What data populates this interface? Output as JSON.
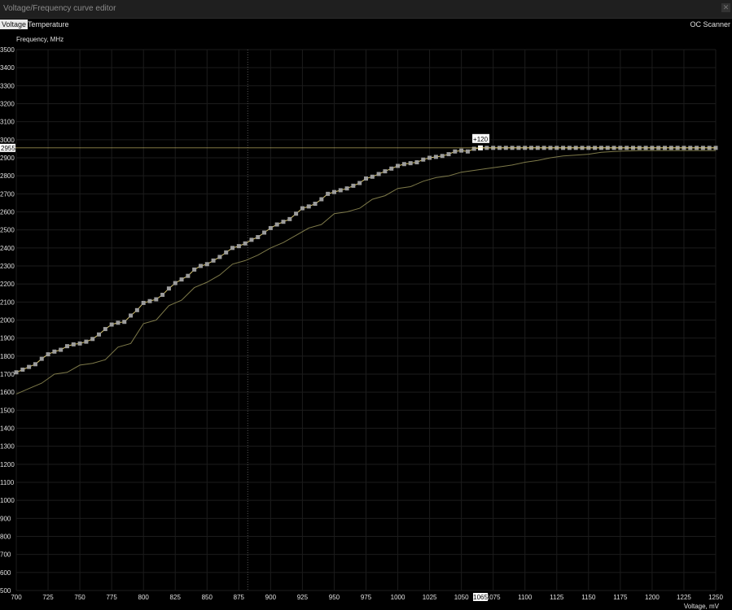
{
  "window": {
    "title": "Voltage/Frequency curve editor",
    "close_icon": "close-icon"
  },
  "tabs": [
    {
      "label": "Voltage",
      "active": true
    },
    {
      "label": "Temperature",
      "active": false
    }
  ],
  "oc_scanner_label": "OC Scanner",
  "colors": {
    "background": "#000000",
    "grid": "#1c1c1c",
    "curve": "#d8c66f",
    "base_curve": "#7e7a4a",
    "points": "#9c9c9c",
    "highlight": "#ffffff"
  },
  "chart_data": {
    "type": "line",
    "xlabel": "Voltage, mV",
    "ylabel": "Frequency, MHz",
    "xlim": [
      700,
      1250
    ],
    "ylim": [
      500,
      3500
    ],
    "x_ticks": [
      700,
      725,
      750,
      775,
      800,
      825,
      850,
      875,
      900,
      925,
      950,
      975,
      1000,
      1025,
      1050,
      1075,
      1100,
      1125,
      1150,
      1175,
      1200,
      1225,
      1250
    ],
    "y_ticks": [
      500,
      600,
      700,
      800,
      900,
      1000,
      1100,
      1200,
      1300,
      1400,
      1500,
      1600,
      1700,
      1800,
      1900,
      2000,
      2100,
      2200,
      2300,
      2400,
      2500,
      2600,
      2700,
      2800,
      2900,
      3000,
      3100,
      3200,
      3300,
      3400,
      3500
    ],
    "grid": true,
    "series": [
      {
        "style": "base",
        "x": [
          700,
          710,
          720,
          730,
          740,
          750,
          760,
          770,
          780,
          790,
          800,
          810,
          820,
          830,
          840,
          850,
          860,
          870,
          880,
          890,
          900,
          910,
          920,
          930,
          940,
          950,
          960,
          970,
          980,
          990,
          1000,
          1010,
          1020,
          1030,
          1040,
          1050,
          1060,
          1070,
          1080,
          1090,
          1100,
          1110,
          1120,
          1130,
          1140,
          1150,
          1160,
          1170,
          1180,
          1190,
          1200,
          1210,
          1220,
          1230,
          1240,
          1250
        ],
        "y": [
          1590,
          1620,
          1650,
          1700,
          1710,
          1750,
          1760,
          1780,
          1850,
          1870,
          1980,
          2000,
          2080,
          2110,
          2180,
          2210,
          2250,
          2310,
          2330,
          2360,
          2400,
          2430,
          2470,
          2510,
          2530,
          2590,
          2600,
          2620,
          2670,
          2690,
          2730,
          2740,
          2770,
          2790,
          2800,
          2820,
          2830,
          2840,
          2850,
          2860,
          2875,
          2885,
          2900,
          2910,
          2915,
          2920,
          2930,
          2935,
          2938,
          2940,
          2940,
          2940,
          2940,
          2940,
          2940,
          2940
        ]
      },
      {
        "style": "edited",
        "x": [
          700,
          705,
          710,
          715,
          720,
          725,
          730,
          735,
          740,
          745,
          750,
          755,
          760,
          765,
          770,
          775,
          780,
          785,
          790,
          795,
          800,
          805,
          810,
          815,
          820,
          825,
          830,
          835,
          840,
          845,
          850,
          855,
          860,
          865,
          870,
          875,
          880,
          885,
          890,
          895,
          900,
          905,
          910,
          915,
          920,
          925,
          930,
          935,
          940,
          945,
          950,
          955,
          960,
          965,
          970,
          975,
          980,
          985,
          990,
          995,
          1000,
          1005,
          1010,
          1015,
          1020,
          1025,
          1030,
          1035,
          1040,
          1045,
          1050,
          1055,
          1060,
          1065,
          1070,
          1075,
          1080,
          1085,
          1090,
          1095,
          1100,
          1105,
          1110,
          1115,
          1120,
          1125,
          1130,
          1135,
          1140,
          1145,
          1150,
          1155,
          1160,
          1165,
          1170,
          1175,
          1180,
          1185,
          1190,
          1195,
          1200,
          1205,
          1210,
          1215,
          1220,
          1225,
          1230,
          1235,
          1240,
          1245,
          1250
        ],
        "y": [
          1710,
          1725,
          1740,
          1755,
          1785,
          1810,
          1825,
          1835,
          1855,
          1865,
          1870,
          1880,
          1895,
          1920,
          1950,
          1975,
          1985,
          1990,
          2025,
          2055,
          2095,
          2105,
          2115,
          2140,
          2175,
          2205,
          2225,
          2245,
          2280,
          2300,
          2310,
          2330,
          2350,
          2375,
          2400,
          2410,
          2425,
          2445,
          2460,
          2485,
          2510,
          2530,
          2545,
          2560,
          2590,
          2620,
          2630,
          2645,
          2670,
          2700,
          2710,
          2720,
          2730,
          2745,
          2760,
          2785,
          2795,
          2810,
          2825,
          2840,
          2855,
          2865,
          2870,
          2875,
          2890,
          2900,
          2905,
          2910,
          2920,
          2935,
          2940,
          2935,
          2950,
          2955,
          2955,
          2955,
          2955,
          2955,
          2955,
          2955,
          2955,
          2955,
          2955,
          2955,
          2955,
          2955,
          2955,
          2955,
          2955,
          2955,
          2955,
          2955,
          2955,
          2955,
          2955,
          2955,
          2955,
          2955,
          2955,
          2955,
          2955,
          2955,
          2955,
          2955,
          2955,
          2955,
          2955,
          2955,
          2955,
          2955,
          2955
        ]
      }
    ],
    "selected_point": {
      "x": 1065,
      "y": 2955,
      "offset_label": "+120"
    },
    "x_highlight_label": "1065",
    "y_highlight_label": "2955",
    "cursor_line_x": 882
  }
}
